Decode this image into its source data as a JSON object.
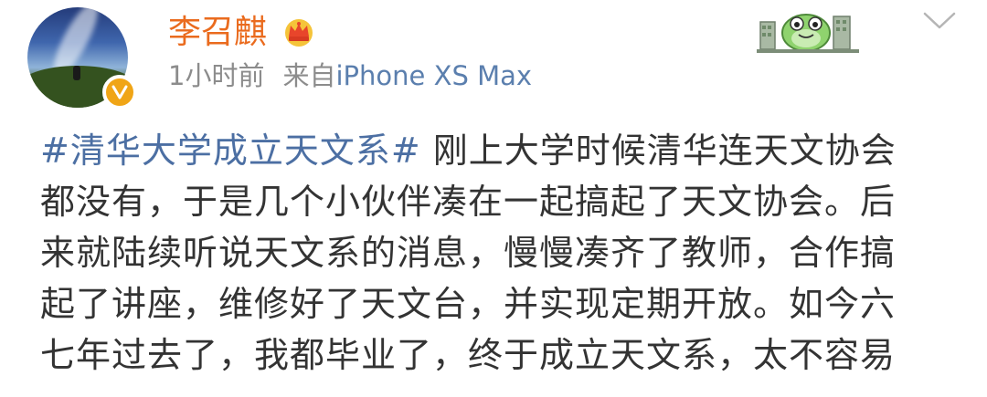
{
  "user": {
    "name": "李召麒"
  },
  "meta": {
    "time": "1小时前",
    "source_prefix": "来自",
    "device": "iPhone XS Max"
  },
  "post": {
    "topic": "#清华大学成立天文系#",
    "lines": [
      " 刚上大学时候清华连天文协会",
      "都没有，于是几个小伙伴凑在一起搞起了天文协会。后",
      "来就陆续听说天文系的消息，慢慢凑齐了教师，合作搞",
      "起了讲座，维修好了天文台，并实现定期开放。如今六",
      "七年过去了，我都毕业了，终于成立天文系，太不容易"
    ]
  },
  "icons": {
    "badge": "verified-badge-icon",
    "crown": "vip-crown-icon",
    "card": "dinosaur-card-illustration",
    "menu": "chevron-down-icon"
  },
  "colors": {
    "username": "#ea6b1e",
    "topic": "#4c6fa3",
    "device": "#5b7fae",
    "meta": "#8c8c8c",
    "text": "#333333",
    "badge": "#f0a516"
  }
}
